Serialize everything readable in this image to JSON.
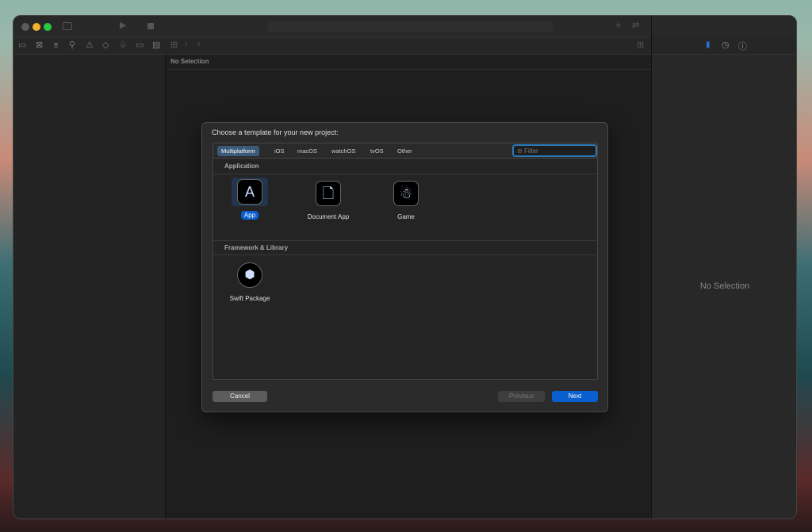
{
  "window": {
    "nav_breadcrumb": "No Selection",
    "inspector_empty": "No Selection"
  },
  "dialog": {
    "title": "Choose a template for your new project:",
    "tabs": [
      "Multiplatform",
      "iOS",
      "macOS",
      "watchOS",
      "tvOS",
      "Other"
    ],
    "filter_placeholder": "Filter",
    "sections": [
      {
        "title": "Application",
        "templates": [
          "App",
          "Document App",
          "Game"
        ]
      },
      {
        "title": "Framework & Library",
        "templates": [
          "Swift Package"
        ]
      }
    ],
    "buttons": {
      "cancel": "Cancel",
      "previous": "Previous",
      "next": "Next"
    }
  },
  "colors": {
    "accent": "#0a5fd0",
    "selected_tab": "#3a5a7a"
  }
}
